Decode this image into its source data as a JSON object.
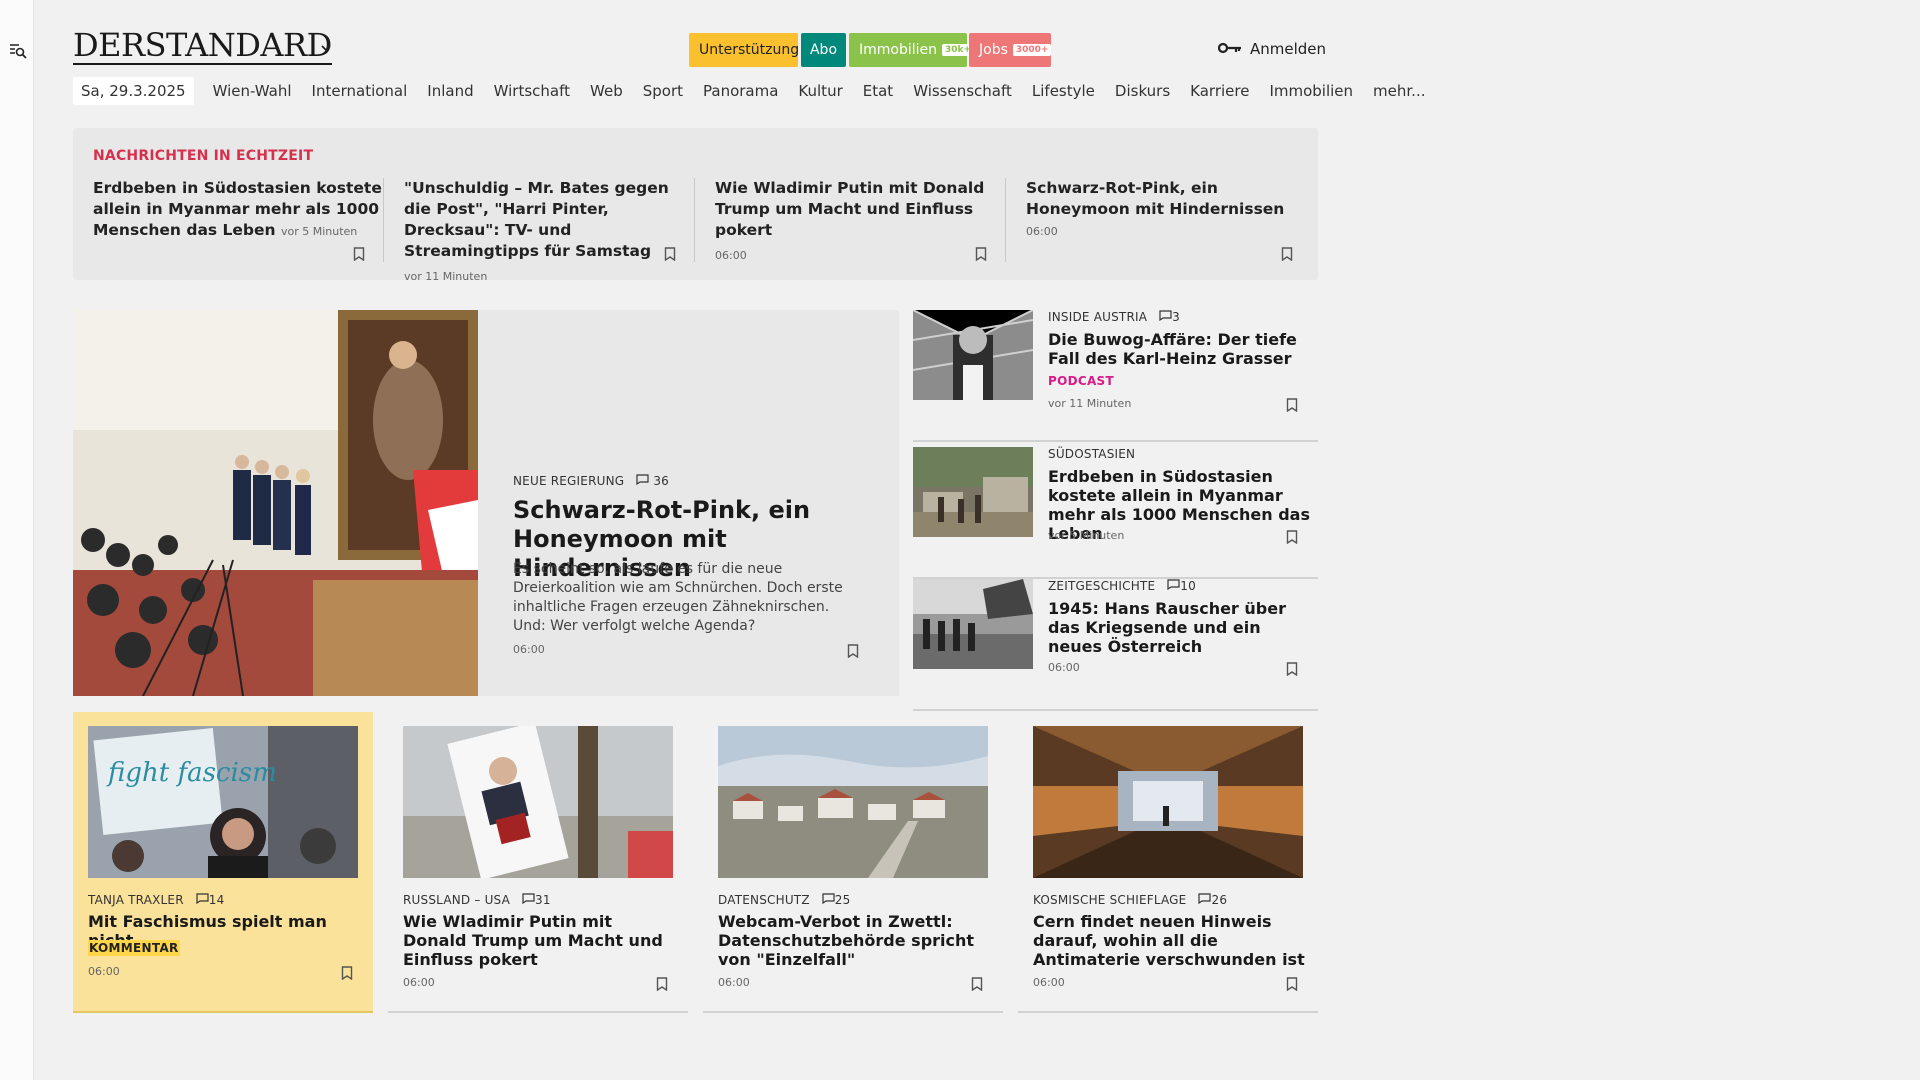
{
  "brand": {
    "logo": "DERSTANDARD"
  },
  "header": {
    "support_label": "Unterstützung",
    "abo_label": "Abo",
    "immo_label": "Immobilien",
    "immo_badge": "30k+",
    "jobs_label": "Jobs",
    "jobs_badge": "3000+",
    "login_label": "Anmelden"
  },
  "nav": {
    "date": "Sa, 29.3.2025",
    "items": [
      "Wien-Wahl",
      "International",
      "Inland",
      "Wirtschaft",
      "Web",
      "Sport",
      "Panorama",
      "Kultur",
      "Etat",
      "Wissenschaft",
      "Lifestyle",
      "Diskurs",
      "Karriere",
      "Immobilien",
      "mehr..."
    ]
  },
  "ticker": {
    "title": "NACHRICHTEN IN ECHTZEIT",
    "items": [
      {
        "headline": "Erdbeben in Südostasien kostete allein in Myanmar mehr als 1000 Menschen das Leben",
        "time": "vor 5 Minuten"
      },
      {
        "headline": "\"Unschuldig – Mr. Bates gegen die Post\", \"Harri Pinter, Drecksau\": TV- und Streamingtipps für Samstag",
        "time": "vor 11 Minuten"
      },
      {
        "headline": "Wie Wladimir Putin mit Donald Trump um Macht und Einfluss pokert",
        "time": "06:00"
      },
      {
        "headline": "Schwarz-Rot-Pink, ein Honeymoon mit Hindernissen",
        "time": "06:00"
      }
    ]
  },
  "lead": {
    "kicker": "NEUE REGIERUNG",
    "comments": "36",
    "title": "Schwarz-Rot-Pink, ein Honeymoon mit Hindernissen",
    "teaser": "Es scheint so, als laufe es für die neue Dreierkoalition wie am Schnürchen. Doch erste inhaltliche Fragen erzeugen Zähneknirschen. Und: Wer verfolgt welche Agenda?",
    "time": "06:00"
  },
  "side": [
    {
      "kicker": "INSIDE AUSTRIA",
      "comments": "3",
      "title": "Die Buwog-Affäre: Der tiefe Fall des Karl-Heinz Grasser",
      "tag": "PODCAST",
      "time": "vor 11 Minuten"
    },
    {
      "kicker": "SÜDOSTASIEN",
      "comments": "",
      "title": "Erdbeben in Südostasien kostete allein in Myanmar mehr als 1000 Menschen das Leben",
      "tag": "",
      "time": "vor 5 Minuten"
    },
    {
      "kicker": "ZEITGESCHICHTE",
      "comments": "10",
      "title": "1945: Hans Rauscher über das Kriegsende und ein neues Österreich",
      "tag": "",
      "time": "06:00"
    }
  ],
  "cards": [
    {
      "kicker": "TANJA TRAXLER",
      "comments": "14",
      "title": "Mit Faschismus spielt man nicht",
      "tag": "KOMMENTAR",
      "time": "06:00",
      "image_text": "fight fascism"
    },
    {
      "kicker": "RUSSLAND – USA",
      "comments": "31",
      "title": "Wie Wladimir Putin mit Donald Trump um Macht und Einfluss pokert",
      "tag": "",
      "time": "06:00"
    },
    {
      "kicker": "DATENSCHUTZ",
      "comments": "25",
      "title": "Webcam-Verbot in Zwettl: Datenschutzbehörde spricht von \"Einzelfall\"",
      "tag": "",
      "time": "06:00"
    },
    {
      "kicker": "KOSMISCHE SCHIEFLAGE",
      "comments": "26",
      "title": "Cern findet neuen Hinweis darauf, wohin all die Antimaterie verschwunden ist",
      "tag": "",
      "time": "06:00"
    }
  ],
  "colors": {
    "accent_red": "#d6304c",
    "podcast": "#d81b87",
    "opinion_bg": "#fbe29a"
  }
}
